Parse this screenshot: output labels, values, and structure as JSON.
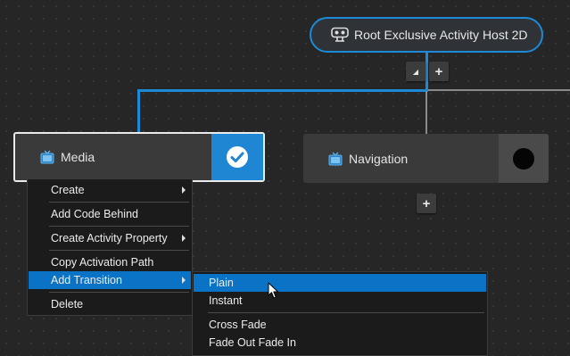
{
  "root_node": {
    "label": "Root Exclusive Activity Host 2D"
  },
  "root_controls": {
    "collapse_glyph": "◢",
    "add_glyph": "+"
  },
  "nodes": [
    {
      "name": "Media",
      "selected": true,
      "status": "checked"
    },
    {
      "name": "Navigation",
      "selected": false,
      "status": "inactive"
    }
  ],
  "navigation_add_glyph": "+",
  "context_menu": {
    "items": [
      {
        "label": "Create",
        "submenu": true
      },
      {
        "label": "Add Code Behind",
        "submenu": false
      },
      {
        "label": "Create Activity Property",
        "submenu": true
      },
      {
        "label": "Copy Activation Path",
        "submenu": false
      },
      {
        "label": "Add Transition",
        "submenu": true,
        "highlighted": true
      },
      {
        "label": "Delete",
        "submenu": false
      }
    ]
  },
  "transition_submenu": {
    "items": [
      {
        "label": "Plain",
        "highlighted": true
      },
      {
        "label": "Instant"
      },
      {
        "label": "Cross Fade"
      },
      {
        "label": "Fade Out Fade In"
      }
    ]
  },
  "colors": {
    "accent": "#1c8ad6",
    "menu_highlight": "#0a73c6",
    "canvas": "#262626"
  }
}
